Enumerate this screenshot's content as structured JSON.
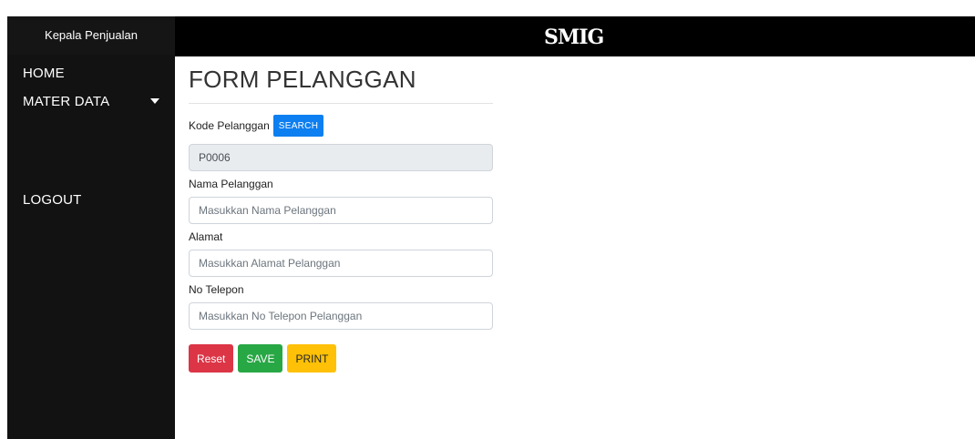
{
  "sidebar": {
    "header": "Kepala Penjualan",
    "items": [
      {
        "label": "HOME"
      },
      {
        "label": "MATER DATA"
      },
      {
        "label": "LOGOUT"
      }
    ]
  },
  "topbar": {
    "logo": "SMIG"
  },
  "form": {
    "title": "FORM PELANGGAN",
    "kode_label": "Kode Pelanggan",
    "search_label": "SEARCH",
    "kode_value": "P0006",
    "nama_label": "Nama Pelanggan",
    "nama_placeholder": "Masukkan Nama Pelanggan",
    "alamat_label": "Alamat",
    "alamat_placeholder": "Masukkan Alamat Pelanggan",
    "telepon_label": "No Telepon",
    "telepon_placeholder": "Masukkan No Telepon Pelanggan",
    "reset_label": "Reset",
    "save_label": "SAVE",
    "print_label": "PRINT"
  },
  "colors": {
    "sidebar": "#121212",
    "topbar": "#000000",
    "search": "#0d7ff0",
    "reset": "#dc3545",
    "save": "#28a745",
    "print": "#ffc107"
  }
}
